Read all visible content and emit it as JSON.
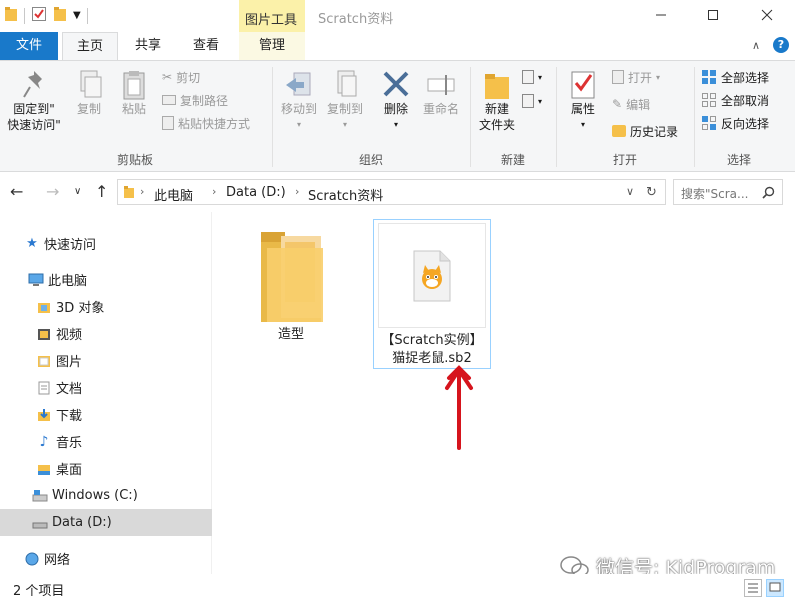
{
  "titlebar": {
    "context_tab": "图片工具",
    "title": "Scratch资料"
  },
  "tabs": {
    "file": "文件",
    "home": "主页",
    "share": "共享",
    "view": "查看",
    "manage": "管理"
  },
  "ribbon": {
    "clipboard": {
      "pin_line1": "固定到\"",
      "pin_line2": "快速访问\"",
      "copy": "复制",
      "paste": "粘贴",
      "cut": "剪切",
      "copy_path": "复制路径",
      "paste_shortcut": "粘贴快捷方式",
      "label": "剪贴板"
    },
    "organize": {
      "move_to": "移动到",
      "copy_to": "复制到",
      "delete": "删除",
      "rename": "重命名",
      "label": "组织"
    },
    "new": {
      "new_folder_line1": "新建",
      "new_folder_line2": "文件夹",
      "label": "新建"
    },
    "open": {
      "properties": "属性",
      "open": "打开",
      "edit": "编辑",
      "history": "历史记录",
      "label": "打开"
    },
    "select": {
      "select_all": "全部选择",
      "select_none": "全部取消",
      "invert": "反向选择",
      "label": "选择"
    }
  },
  "address": {
    "crumbs": [
      "此电脑",
      "Data (D:)",
      "Scratch资料"
    ],
    "search_placeholder": "搜索\"Scra..."
  },
  "nav": {
    "items": [
      {
        "label": "快速访问"
      },
      {
        "label": "此电脑"
      },
      {
        "label": "3D 对象"
      },
      {
        "label": "视频"
      },
      {
        "label": "图片"
      },
      {
        "label": "文档"
      },
      {
        "label": "下载"
      },
      {
        "label": "音乐"
      },
      {
        "label": "桌面"
      },
      {
        "label": "Windows (C:)"
      },
      {
        "label": "Data (D:)"
      },
      {
        "label": "网络"
      }
    ]
  },
  "files": [
    {
      "name": "造型"
    },
    {
      "name_line1": "【Scratch实例】",
      "name_line2": "猫捉老鼠.sb2"
    }
  ],
  "status": {
    "count": "2 个项目"
  },
  "watermark": {
    "text": "微信号: KidProgram"
  },
  "colors": {
    "file_tab": "#1979ca",
    "context_tab": "#fbf1a9",
    "selection_border": "#99d1ff",
    "annotation_arrow": "#d6141d"
  }
}
